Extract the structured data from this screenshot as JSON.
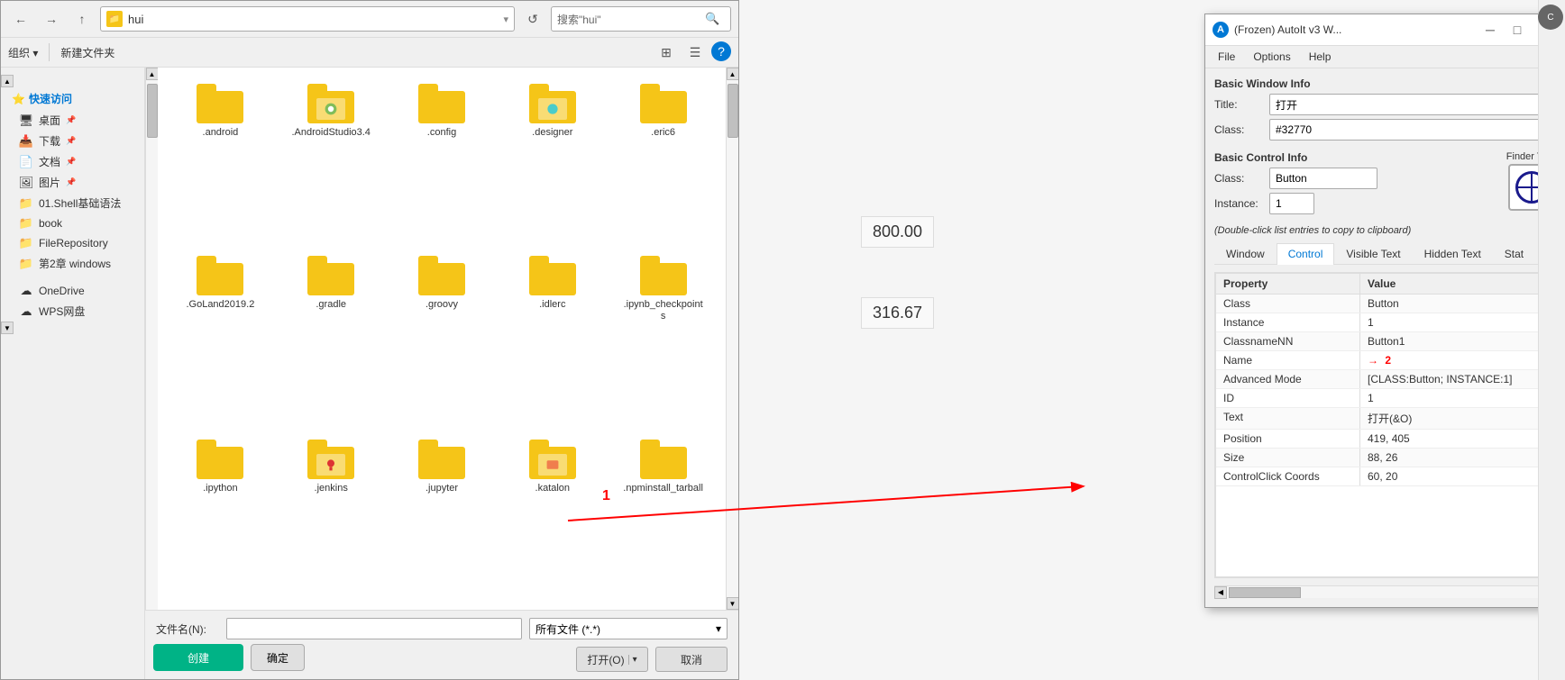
{
  "explorer": {
    "title": "hui",
    "address": {
      "icon": "📁",
      "path": "hui",
      "search_placeholder": "搜索\"hui\""
    },
    "toolbar": {
      "organize_label": "组织 ▾",
      "new_folder_label": "新建文件夹"
    },
    "sidebar": {
      "quick_access_label": "快速访问",
      "items": [
        {
          "label": "桌面",
          "has_pin": true
        },
        {
          "label": "下载",
          "has_pin": true
        },
        {
          "label": "文档",
          "has_pin": true
        },
        {
          "label": "图片",
          "has_pin": true
        },
        {
          "label": "01.Shell基础语法"
        },
        {
          "label": "book"
        },
        {
          "label": "FileRepository"
        },
        {
          "label": "第2章 windows"
        }
      ],
      "onedrive_label": "OneDrive",
      "wps_label": "WPS网盘"
    },
    "files": [
      {
        "name": ".android",
        "type": "folder"
      },
      {
        "name": ".AndroidStudio3.4",
        "type": "folder"
      },
      {
        "name": ".config",
        "type": "folder"
      },
      {
        "name": ".designer",
        "type": "folder",
        "has_overlay": true
      },
      {
        "name": ".eric6",
        "type": "folder"
      },
      {
        "name": ".GoLand2019.2",
        "type": "folder"
      },
      {
        "name": ".gradle",
        "type": "folder"
      },
      {
        "name": ".groovy",
        "type": "folder"
      },
      {
        "name": ".idlerc",
        "type": "folder"
      },
      {
        "name": ".ipynb_checkpoints",
        "type": "folder"
      },
      {
        "name": ".ipython",
        "type": "folder"
      },
      {
        "name": ".jenkins",
        "type": "folder",
        "has_overlay": true
      },
      {
        "name": ".jupyter",
        "type": "folder"
      },
      {
        "name": ".katalon",
        "type": "folder",
        "has_overlay": true
      },
      {
        "name": ".npminstall_tarball",
        "type": "folder"
      }
    ],
    "bottom": {
      "filename_label": "文件名(N):",
      "filetype_label": "所有文件 (*.*)",
      "open_btn": "打开(O)",
      "cancel_btn": "取消"
    }
  },
  "bg_prices": {
    "price1": "800.00",
    "price2": "316.67"
  },
  "annotation": {
    "number1": "1",
    "number2": "2"
  },
  "autoit": {
    "title": "(Frozen) AutoIt v3 W...",
    "icon": "A",
    "menu": {
      "file": "File",
      "options": "Options",
      "help": "Help"
    },
    "basic_window_info": "Basic Window Info",
    "title_label": "Title:",
    "title_value": "打开",
    "class_label": "Class:",
    "class_value": "#32770",
    "basic_control_info": "Basic Control Info",
    "finder_tool_label": "Finder Tool",
    "control_class_label": "Class:",
    "control_class_value": "Button",
    "instance_label": "Instance:",
    "instance_value": "1",
    "double_click_note": "(Double-click list entries to copy to clipboard)",
    "tabs": [
      "Window",
      "Control",
      "Visible Text",
      "Hidden Text",
      "Stat"
    ],
    "active_tab": "Control",
    "table": {
      "col_property": "Property",
      "col_value": "Value",
      "rows": [
        {
          "property": "Class",
          "value": "Button"
        },
        {
          "property": "Instance",
          "value": "1"
        },
        {
          "property": "ClassnameNN",
          "value": "Button1"
        },
        {
          "property": "Name",
          "value": ""
        },
        {
          "property": "Advanced Mode",
          "value": "[CLASS:Button; INSTANCE:1]"
        },
        {
          "property": "ID",
          "value": "1"
        },
        {
          "property": "Text",
          "value": "打开(&O)"
        },
        {
          "property": "Position",
          "value": "419, 405"
        },
        {
          "property": "Size",
          "value": "88, 26"
        },
        {
          "property": "ControlClick Coords",
          "value": "60, 20"
        }
      ]
    }
  },
  "bottom_buttons": {
    "create": "创建",
    "ok": "确定"
  }
}
